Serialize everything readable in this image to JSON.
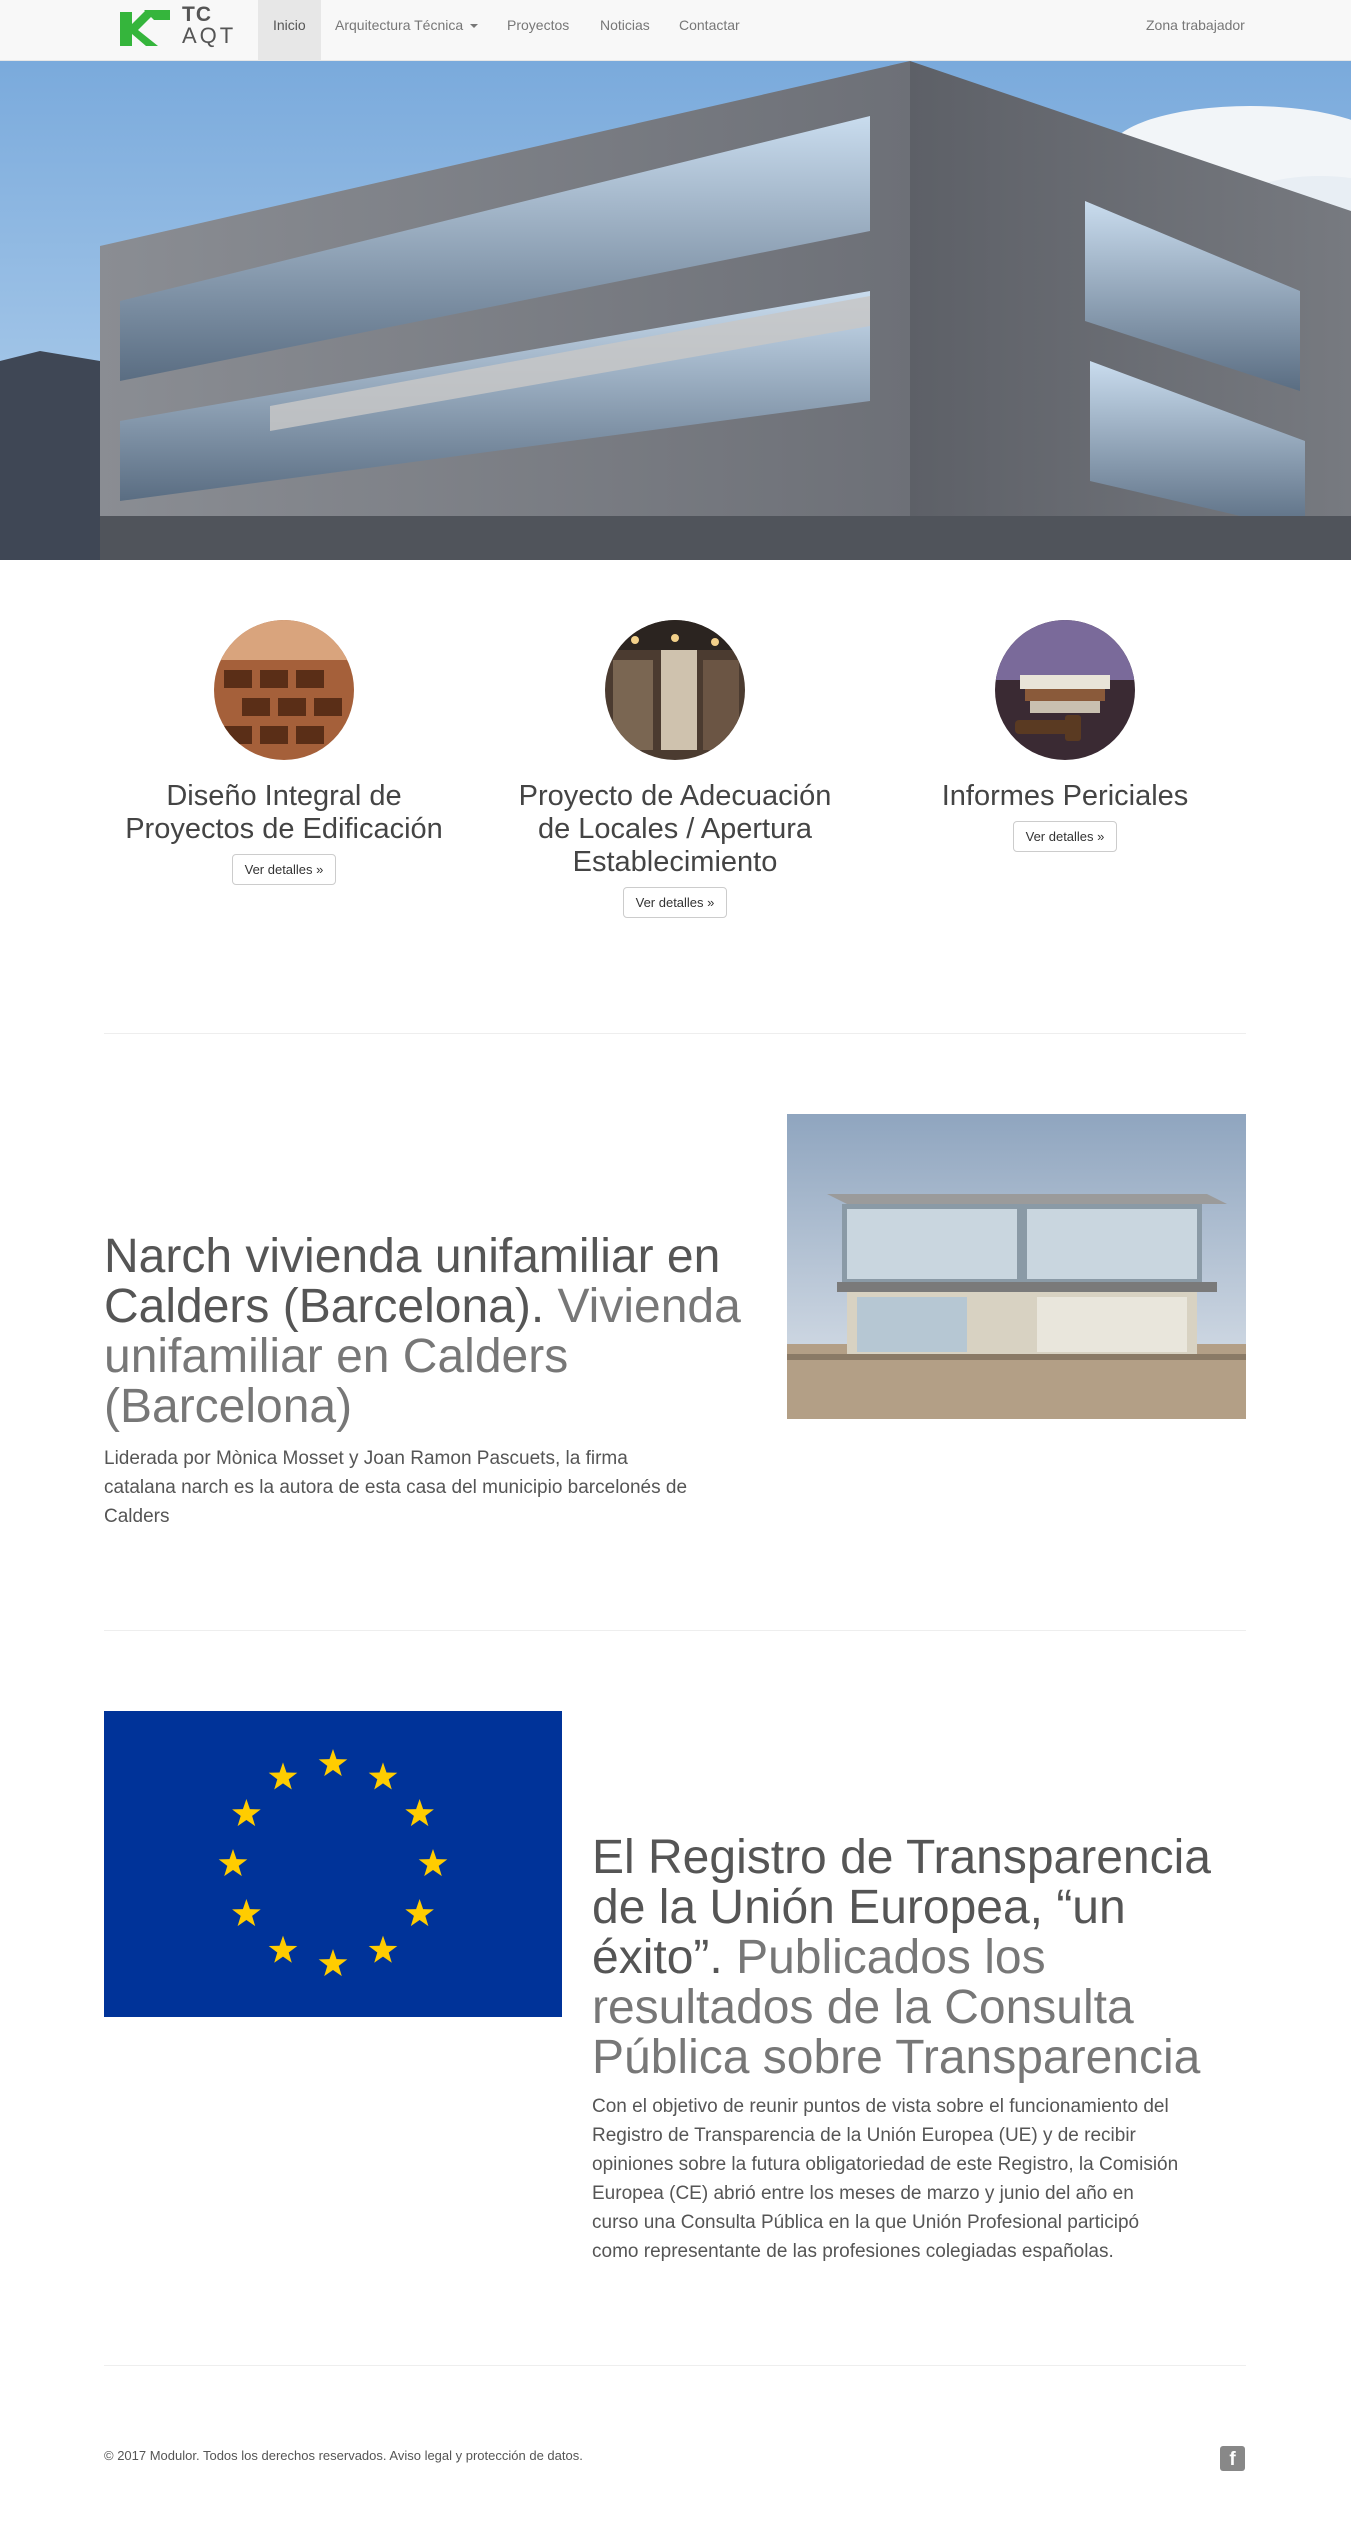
{
  "brand": {
    "line1": "TC",
    "line2": "AQT",
    "colors": {
      "green": "#35b53c",
      "dark": "#555555"
    }
  },
  "nav": {
    "items": [
      {
        "label": "Inicio",
        "active": true
      },
      {
        "label": "Arquitectura Técnica",
        "dropdown": true
      },
      {
        "label": "Proyectos"
      },
      {
        "label": "Noticias"
      },
      {
        "label": "Contactar"
      }
    ],
    "right": "Zona trabajador"
  },
  "features": [
    {
      "title_lines": [
        "Diseño Integral de",
        "Proyectos de Edificación"
      ],
      "button": "Ver detalles »",
      "icon": "bricks-image"
    },
    {
      "title_lines": [
        "Proyecto de Adecuación",
        "de Locales / Apertura",
        "Establecimiento"
      ],
      "button": "Ver detalles »",
      "icon": "shop-interior-image"
    },
    {
      "title_lines": [
        "Informes Periciales"
      ],
      "button": "Ver detalles »",
      "icon": "gavel-books-image"
    }
  ],
  "articles": [
    {
      "head_lines": [
        "Narch vivienda unifamiliar en",
        "Calders (Barcelona).",
        "Vivienda",
        "unifamiliar en Calders",
        "(Barcelona)"
      ],
      "body_lines": [
        "Liderada por Mònica Mosset y Joan Ramon Pascuets, la firma",
        "catalana narch es la autora de esta casa del municipio barcelonés de",
        "Calders"
      ]
    },
    {
      "head_lines": [
        "El Registro de Transparencia",
        "de la Unión Europea, “un",
        "éxito”.",
        "Publicados los",
        "resultados de la Consulta",
        "Pública sobre Transparencia"
      ],
      "body_lines": [
        "Con el objetivo de reunir puntos de vista sobre el funcionamiento del",
        "Registro de Transparencia de la Unión Europea (UE) y de recibir",
        "opiniones sobre la futura obligatoriedad de este Registro, la Comisión",
        "Europea (CE) abrió entre los meses de marzo y junio del año en",
        "curso una Consulta Pública en la que Unión Profesional participó",
        "como representante de las profesiones colegiadas españolas."
      ]
    }
  ],
  "footer": {
    "text": "© 2017 Modulor. Todos los derechos reservados. Aviso legal y protección de datos.",
    "social_icon": "facebook-icon",
    "social_glyph": "f"
  },
  "colors": {
    "eu_blue": "#003399",
    "eu_star": "#ffcc00"
  }
}
